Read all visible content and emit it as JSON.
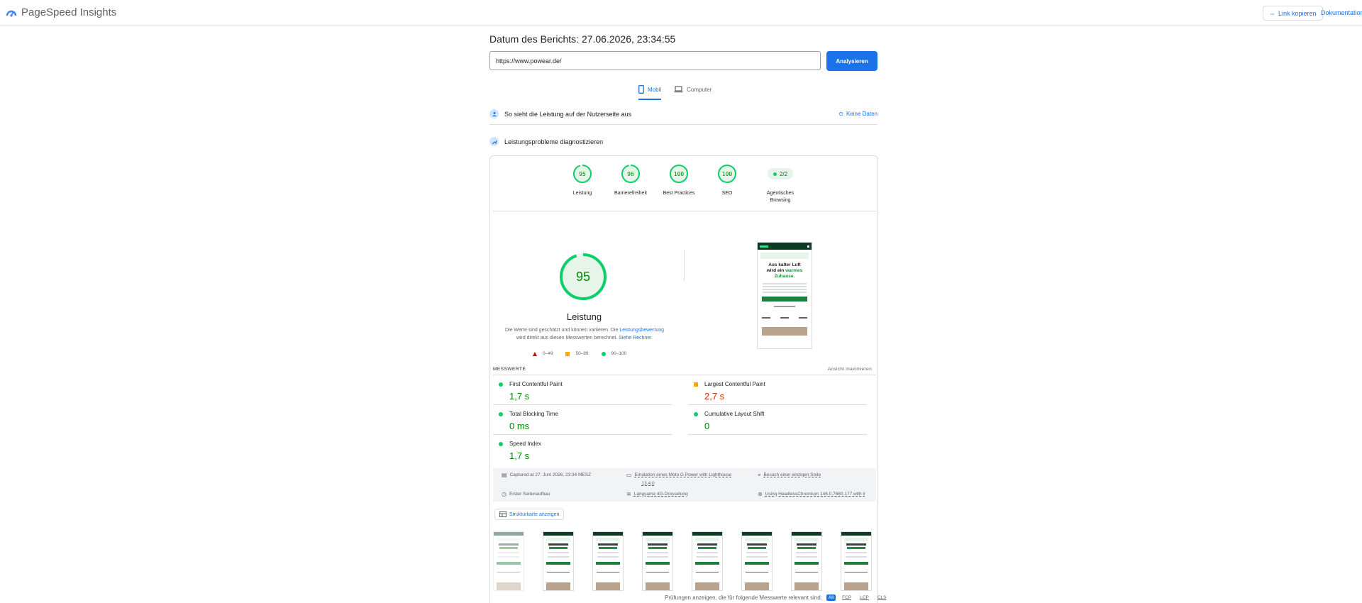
{
  "app": {
    "title": "PageSpeed Insights",
    "copy_link_label": "Link kopieren",
    "docs_label": "Dokumentation"
  },
  "report": {
    "date_label": "Datum des Berichts: 27.06.2026, 23:34:55",
    "url_value": "https://www.powear.de/",
    "analyze_label": "Analysieren"
  },
  "tabs": [
    {
      "label": "Mobil",
      "active": true
    },
    {
      "label": "Computer",
      "active": false
    }
  ],
  "field_section": {
    "title": "So sieht die Leistung auf der Nutzerseite aus",
    "no_data_label": "Keine Daten"
  },
  "lab_section": {
    "title": "Leistungsprobleme diagnostizieren"
  },
  "categories": [
    {
      "label": "Leistung",
      "score": "95",
      "fraction": 0.95
    },
    {
      "label": "Barrierefreiheit",
      "score": "96",
      "fraction": 0.96
    },
    {
      "label": "Best Practices",
      "score": "100",
      "fraction": 1.0
    },
    {
      "label": "SEO",
      "score": "100",
      "fraction": 1.0
    },
    {
      "label": "Agentisches Browsing",
      "badge": "2/2"
    }
  ],
  "performance": {
    "score": "95",
    "fraction": 0.95,
    "title": "Leistung",
    "desc_part1": "Die Werte sind geschätzt und können variieren. Die ",
    "desc_link1": "Leistungsbewertung",
    "desc_part2": " wird direkt aus diesen Messwerten berechnet. ",
    "desc_link2": "Siehe Rechner.",
    "legend": [
      "0–49",
      "50–89",
      "90–100"
    ]
  },
  "screenshot": {
    "headline_1": "Aus kalter Luft",
    "headline_2a": "wird ein ",
    "headline_2b": "warmes",
    "headline_3": "Zuhause."
  },
  "metrics": {
    "section_title": "MESSWERTE",
    "expand_label": "Ansicht maximieren",
    "items": [
      {
        "name": "First Contentful Paint",
        "value": "1,7 s",
        "status": "good"
      },
      {
        "name": "Largest Contentful Paint",
        "value": "2,7 s",
        "status": "average"
      },
      {
        "name": "Total Blocking Time",
        "value": "0 ms",
        "status": "good"
      },
      {
        "name": "Cumulative Layout Shift",
        "value": "0",
        "status": "good"
      },
      {
        "name": "Speed Index",
        "value": "1,7 s",
        "status": "good"
      }
    ]
  },
  "run_info": {
    "captured": "Captured at 27. Juni 2026, 23:34 MESZ",
    "emulation_1": "Emulation eines Moto G Power with Lighthouse",
    "emulation_2": "13.4.0",
    "session": "Besuch einer einzigen Seite",
    "load": "Erster Seitenaufbau",
    "throttling": "Langsame 4G-Drosselung",
    "browser": "Using HeadlessChromium 146.0.7680.177 with lr"
  },
  "treemap_label": "Strukturkarte anzeigen",
  "audit_filter": {
    "label": "Prüfungen anzeigen, die für folgende Messwerte relevant sind:",
    "chips": [
      "All",
      "FCP",
      "LCP",
      "CLS"
    ]
  },
  "colors": {
    "accent": "#1a73e8",
    "good": "#0cce6b",
    "good_text": "#008800",
    "average": "#ffa400",
    "poor": "#cc0000"
  }
}
